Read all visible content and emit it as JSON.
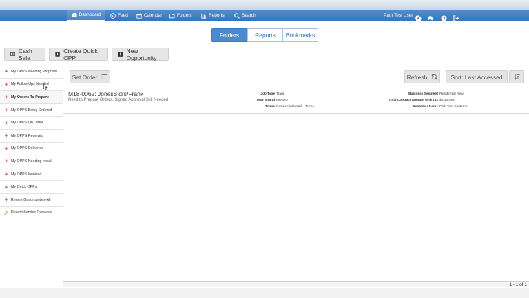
{
  "nav": {
    "dashboard": "Dashboard",
    "feed": "Feed",
    "calendar": "Calendar",
    "folders": "Folders",
    "reports": "Reports",
    "search": "Search",
    "user": "Path Test User"
  },
  "tabs": {
    "folders": "Folders",
    "reports": "Reports",
    "bookmarks": "Bookmarks"
  },
  "actions": {
    "cash_sale": "Cash Sale",
    "quick_opp": "Create Quick OPP",
    "new_opp": "New Opportunity"
  },
  "sidebar": {
    "items": [
      {
        "label": "My OPPS Needing Proposal"
      },
      {
        "label": "My Follow Ups Needed"
      },
      {
        "label": "My Orders To Prepare"
      },
      {
        "label": "My OPPS Being Ordered"
      },
      {
        "label": "My OPPS On Order"
      },
      {
        "label": "My OPPS Received"
      },
      {
        "label": "My OPPS Delivered"
      },
      {
        "label": "My OPPS Needing Install"
      },
      {
        "label": "My OPPS Invoiced"
      },
      {
        "label": "My Quick OPPs"
      },
      {
        "label": "Recent Opportunities-All"
      },
      {
        "label": "Recent Service Requests"
      }
    ]
  },
  "toolbar": {
    "set_order": "Set Order",
    "refresh": "Refresh",
    "sort": "Sort: Last Accessed"
  },
  "record": {
    "title": "M18-0062: JonesBldrs/Frank",
    "subtitle": "Need to Prepare Orders, Signed Approval Still Needed",
    "job_type_label": "Job Type",
    "job_type": "Trade",
    "main_brand_label": "Main Brand",
    "main_brand": "Integrity",
    "terms_label": "Terms",
    "terms": "Residential Install - Terms",
    "segment_label": "Business Segment",
    "segment": "Residential New",
    "amount_label": "Total Contract Amount with Tax",
    "amount": "$6,330.94",
    "customer_label": "Customer Name",
    "customer": "Path Test Customer"
  },
  "pager": {
    "text": "1 - 1 of 1"
  },
  "colors": {
    "nav_blue": "#3f80c6",
    "accent_red": "#d9534f",
    "accent_orange": "#e0a030"
  }
}
